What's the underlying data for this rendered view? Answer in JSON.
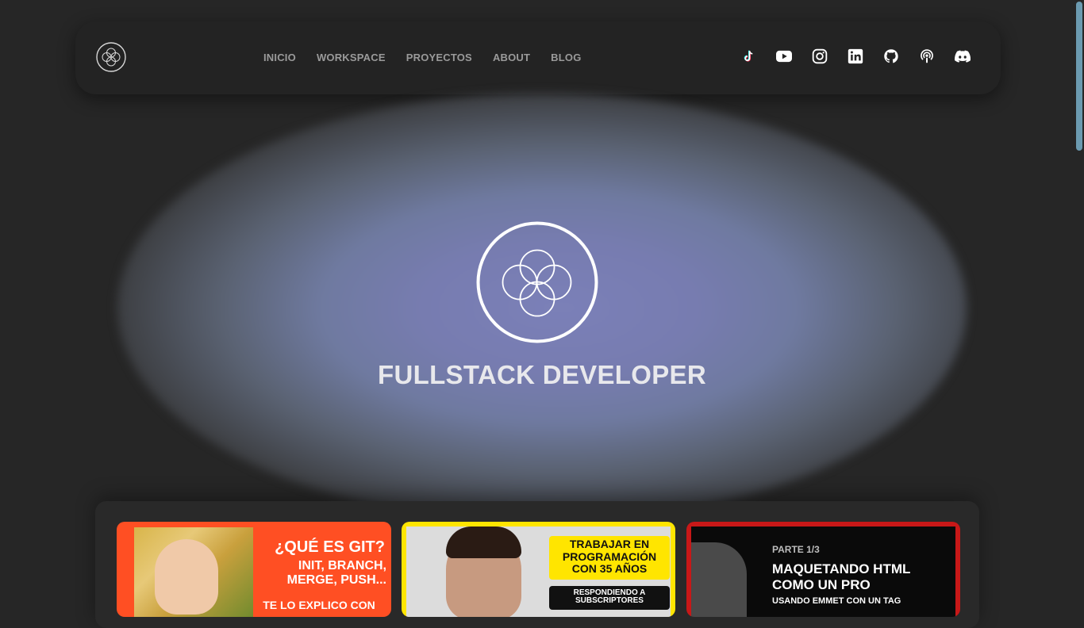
{
  "nav": {
    "links": [
      {
        "label": "INICIO"
      },
      {
        "label": "WORKSPACE"
      },
      {
        "label": "PROYECTOS"
      },
      {
        "label": "ABOUT"
      },
      {
        "label": "BLOG"
      }
    ],
    "socials": [
      "tiktok-icon",
      "youtube-icon",
      "instagram-icon",
      "linkedin-icon",
      "github-icon",
      "podcast-icon",
      "discord-icon"
    ]
  },
  "hero": {
    "title": "FULLSTACK DEVELOPER"
  },
  "cards": [
    {
      "title": "¿QUÉ ES GIT?",
      "subtitle": "INIT, BRANCH, MERGE, PUSH...",
      "cut_text": "TE LO EXPLICO CON"
    },
    {
      "title": "TRABAJAR EN PROGRAMACIÓN CON 35 AÑOS",
      "badge": "RESPONDIENDO A SUBSCRIPTORES"
    },
    {
      "part": "PARTE 1/3",
      "title": "MAQUETANDO HTML COMO UN PRO",
      "subtitle": "USANDO EMMET CON UN TAG"
    }
  ],
  "colors": {
    "background": "#262626",
    "navbar": "#232323",
    "hero_glow": "#7b80b8",
    "card1": "#ff4f23",
    "card2": "#ffe500",
    "card3": "#c81818"
  }
}
